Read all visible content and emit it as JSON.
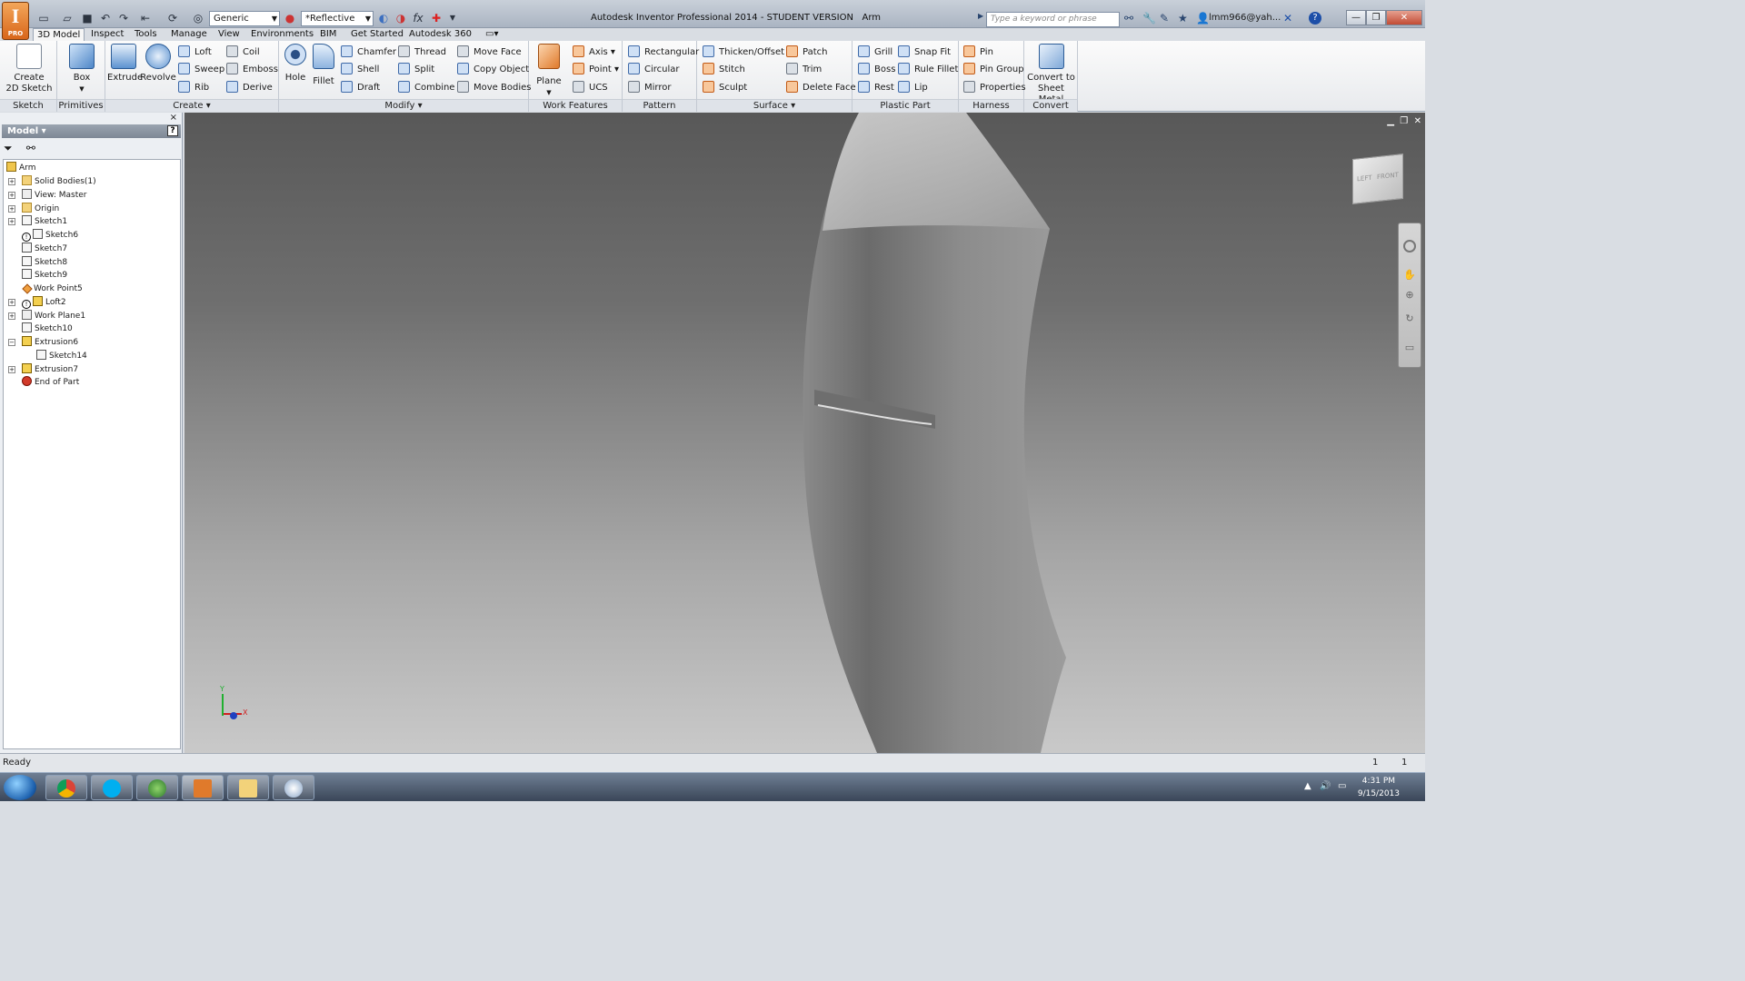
{
  "titlebar": {
    "app_letter": "I",
    "app_badge": "PRO",
    "material_combo": "Generic",
    "appearance_combo": "*Reflective",
    "fx_label": "fx",
    "title": "Autodesk Inventor Professional 2014 - STUDENT VERSION",
    "document": "Arm",
    "search_placeholder": "Type a keyword or phrase",
    "user": "lmm966@yah...",
    "help": "?"
  },
  "tabs": [
    "3D Model",
    "Inspect",
    "Tools",
    "Manage",
    "View",
    "Environments",
    "BIM",
    "Get Started",
    "Autodesk 360"
  ],
  "ribbon": {
    "sketch": {
      "title": "Sketch",
      "create": "Create",
      "sketch2d": "2D Sketch"
    },
    "primitives": {
      "title": "Primitives",
      "box": "Box"
    },
    "create": {
      "title": "Create",
      "extrude": "Extrude",
      "revolve": "Revolve",
      "loft": "Loft",
      "sweep": "Sweep",
      "rib": "Rib",
      "coil": "Coil",
      "emboss": "Emboss",
      "derive": "Derive"
    },
    "modify": {
      "title": "Modify",
      "hole": "Hole",
      "fillet": "Fillet",
      "chamfer": "Chamfer",
      "shell": "Shell",
      "draft": "Draft",
      "thread": "Thread",
      "split": "Split",
      "combine": "Combine",
      "move_face": "Move Face",
      "copy_object": "Copy Object",
      "move_bodies": "Move Bodies"
    },
    "work_features": {
      "title": "Work Features",
      "plane": "Plane",
      "axis": "Axis",
      "point": "Point",
      "ucs": "UCS"
    },
    "pattern": {
      "title": "Pattern",
      "rectangular": "Rectangular",
      "circular": "Circular",
      "mirror": "Mirror"
    },
    "surface": {
      "title": "Surface",
      "thicken": "Thicken/Offset",
      "stitch": "Stitch",
      "sculpt": "Sculpt",
      "patch": "Patch",
      "trim": "Trim",
      "delete_face": "Delete Face"
    },
    "plastic_part": {
      "title": "Plastic Part",
      "grill": "Grill",
      "boss": "Boss",
      "rest": "Rest",
      "snap_fit": "Snap Fit",
      "rule_fillet": "Rule Fillet",
      "lip": "Lip"
    },
    "harness": {
      "title": "Harness",
      "pin": "Pin",
      "pin_group": "Pin Group",
      "properties": "Properties"
    },
    "convert": {
      "title": "Convert",
      "line1": "Convert to",
      "line2": "Sheet Metal"
    }
  },
  "browser": {
    "title": "Model",
    "help": "?",
    "close": "×",
    "tree": [
      {
        "label": "Arm",
        "icon": "part"
      },
      {
        "label": "Solid Bodies(1)",
        "icon": "folder"
      },
      {
        "label": "View: Master",
        "icon": "view"
      },
      {
        "label": "Origin",
        "icon": "folder"
      },
      {
        "label": "Sketch1",
        "icon": "sketch"
      },
      {
        "label": "Sketch6",
        "icon": "sketch"
      },
      {
        "label": "Sketch7",
        "icon": "sketch"
      },
      {
        "label": "Sketch8",
        "icon": "sketch"
      },
      {
        "label": "Sketch9",
        "icon": "sketch"
      },
      {
        "label": "Work Point5",
        "icon": "workpoint"
      },
      {
        "label": "Loft2",
        "icon": "loft"
      },
      {
        "label": "Work Plane1",
        "icon": "workplane"
      },
      {
        "label": "Sketch10",
        "icon": "sketch"
      },
      {
        "label": "Extrusion6",
        "icon": "extrusion"
      },
      {
        "label": "Sketch14",
        "icon": "sketch"
      },
      {
        "label": "Extrusion7",
        "icon": "extrusion"
      },
      {
        "label": "End of Part",
        "icon": "end"
      }
    ],
    "warning_glyph": "!"
  },
  "viewcube": {
    "left": "LEFT",
    "front": "FRONT"
  },
  "triad": {
    "x": "X",
    "y": "Y"
  },
  "status": {
    "text": "Ready",
    "num1": "1",
    "num2": "1"
  },
  "taskbar": {
    "time": "4:31 PM",
    "date": "9/15/2013"
  },
  "colors": {
    "accent": "#e07a2b",
    "viewport_top": "#585858",
    "viewport_bottom": "#c9c9c9"
  }
}
